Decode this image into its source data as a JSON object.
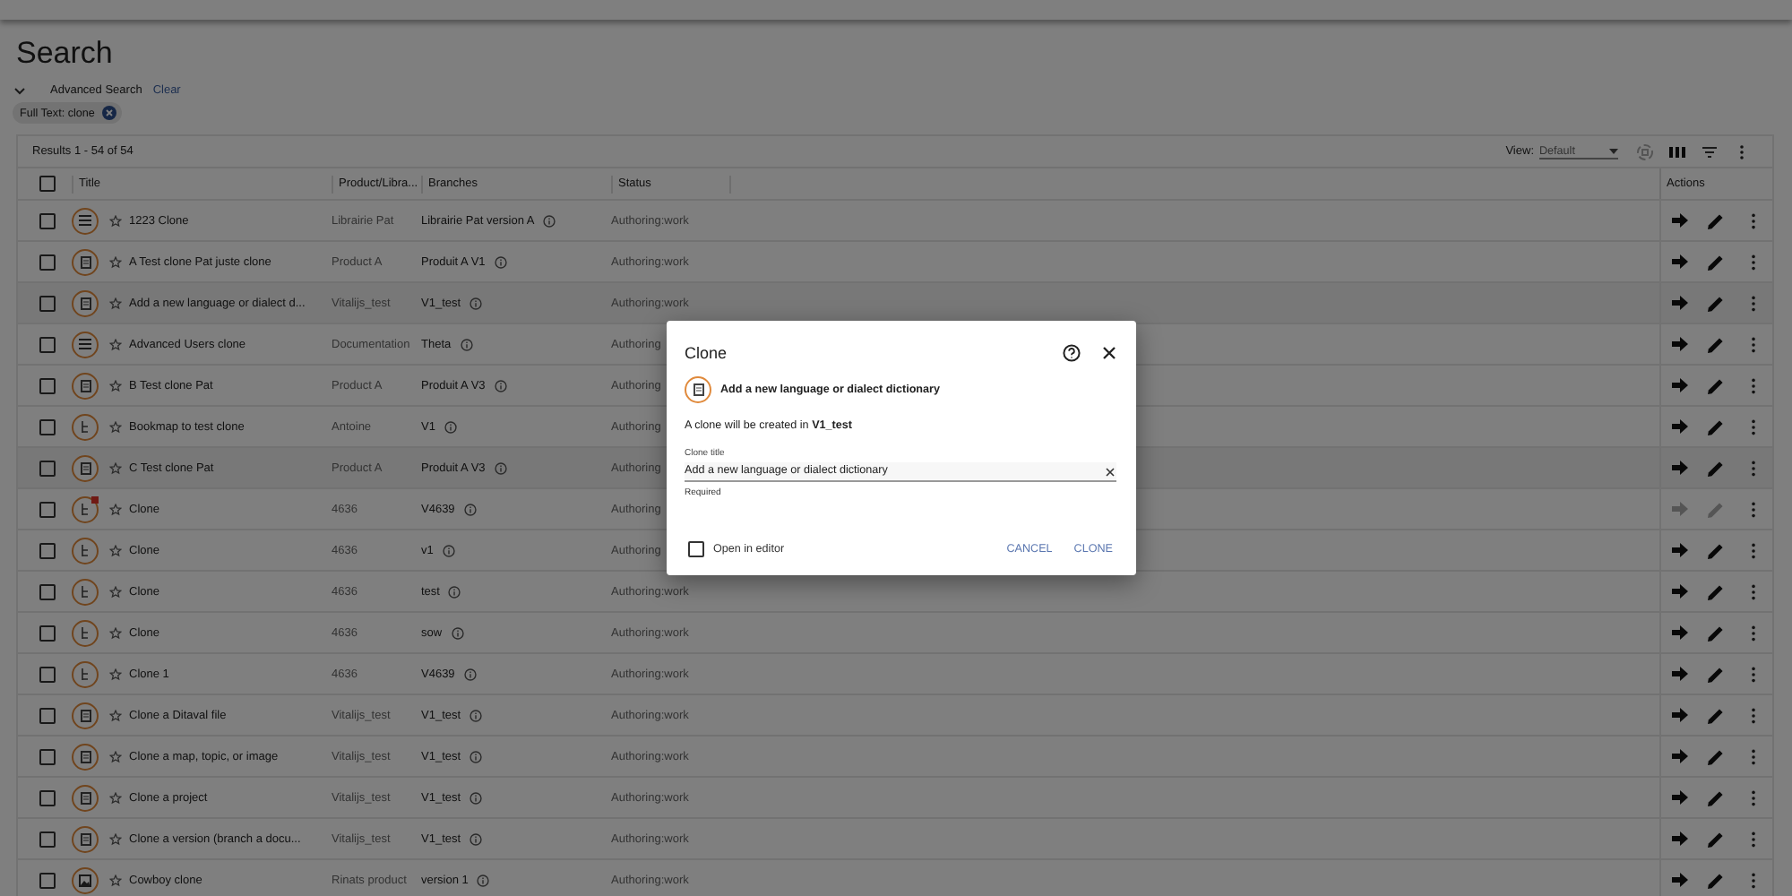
{
  "page": {
    "title": "Search"
  },
  "advanced_search": {
    "label": "Advanced Search",
    "clear": "Clear"
  },
  "filters": [
    {
      "label": "Full Text: clone"
    }
  ],
  "results": {
    "summary": "Results 1 - 54 of 54",
    "view_label": "View:",
    "view_value": "Default"
  },
  "table": {
    "header_checked": false,
    "columns": [
      "Title",
      "Product/Libra...",
      "Branches",
      "Status"
    ],
    "actions_column": "Actions",
    "rows": [
      {
        "kind": "list",
        "title": "1223 Clone",
        "product": "Librairie Pat",
        "branch": "Librairie Pat version A",
        "status": "Authoring:work",
        "checked": false,
        "highlighted": false,
        "alert": false,
        "actions_disabled": false
      },
      {
        "kind": "doc",
        "title": "A Test clone Pat juste clone",
        "product": "Product A",
        "branch": "Produit A V1",
        "status": "Authoring:work",
        "checked": false,
        "highlighted": false,
        "alert": false,
        "actions_disabled": false
      },
      {
        "kind": "doc",
        "title": "Add a new language or dialect d...",
        "product": "Vitalijs_test",
        "branch": "V1_test",
        "status": "Authoring:work",
        "checked": false,
        "highlighted": true,
        "alert": false,
        "actions_disabled": false
      },
      {
        "kind": "list",
        "title": "Advanced Users clone",
        "product": "Documentation",
        "branch": "Theta",
        "status": "Authoring",
        "checked": false,
        "highlighted": false,
        "alert": false,
        "actions_disabled": false
      },
      {
        "kind": "doc",
        "title": "B Test clone Pat",
        "product": "Product A",
        "branch": "Produit A V3",
        "status": "Authoring",
        "checked": false,
        "highlighted": false,
        "alert": false,
        "actions_disabled": false
      },
      {
        "kind": "map",
        "title": "Bookmap to test clone",
        "product": "Antoine",
        "branch": "V1",
        "status": "Authoring",
        "checked": false,
        "highlighted": false,
        "alert": false,
        "actions_disabled": false
      },
      {
        "kind": "doc",
        "title": "C Test clone Pat",
        "product": "Product A",
        "branch": "Produit A V3",
        "status": "Authoring",
        "checked": false,
        "highlighted": true,
        "alert": false,
        "actions_disabled": false
      },
      {
        "kind": "map",
        "title": "Clone",
        "product": "4636",
        "branch": "V4639",
        "status": "Authoring",
        "checked": false,
        "highlighted": false,
        "alert": true,
        "actions_disabled": true
      },
      {
        "kind": "map",
        "title": "Clone",
        "product": "4636",
        "branch": "v1",
        "status": "Authoring",
        "checked": false,
        "highlighted": false,
        "alert": false,
        "actions_disabled": false
      },
      {
        "kind": "map",
        "title": "Clone",
        "product": "4636",
        "branch": "test",
        "status": "Authoring:work",
        "checked": false,
        "highlighted": false,
        "alert": false,
        "actions_disabled": false
      },
      {
        "kind": "map",
        "title": "Clone",
        "product": "4636",
        "branch": "sow",
        "status": "Authoring:work",
        "checked": false,
        "highlighted": false,
        "alert": false,
        "actions_disabled": false
      },
      {
        "kind": "map",
        "title": "Clone 1",
        "product": "4636",
        "branch": "V4639",
        "status": "Authoring:work",
        "checked": false,
        "highlighted": false,
        "alert": false,
        "actions_disabled": false
      },
      {
        "kind": "doc",
        "title": "Clone a Ditaval file",
        "product": "Vitalijs_test",
        "branch": "V1_test",
        "status": "Authoring:work",
        "checked": false,
        "highlighted": false,
        "alert": false,
        "actions_disabled": false
      },
      {
        "kind": "doc",
        "title": "Clone a map, topic, or image",
        "product": "Vitalijs_test",
        "branch": "V1_test",
        "status": "Authoring:work",
        "checked": false,
        "highlighted": false,
        "alert": false,
        "actions_disabled": false
      },
      {
        "kind": "doc",
        "title": "Clone a project",
        "product": "Vitalijs_test",
        "branch": "V1_test",
        "status": "Authoring:work",
        "checked": false,
        "highlighted": false,
        "alert": false,
        "actions_disabled": false
      },
      {
        "kind": "doc",
        "title": "Clone a version (branch a docu...",
        "product": "Vitalijs_test",
        "branch": "V1_test",
        "status": "Authoring:work",
        "checked": false,
        "highlighted": false,
        "alert": false,
        "actions_disabled": false
      },
      {
        "kind": "image",
        "title": "Cowboy clone",
        "product": "Rinats product",
        "branch": "version 1",
        "status": "Authoring:work",
        "checked": false,
        "highlighted": false,
        "alert": false,
        "actions_disabled": false
      }
    ]
  },
  "dialog": {
    "title": "Clone",
    "item": {
      "kind": "doc",
      "title": "Add a new language or dialect dictionary"
    },
    "message": "A clone will be created in **V1_test**",
    "field_label": "Clone title",
    "field_value": "Add a new language or dialect dictionary",
    "helper": "Required",
    "open_in_editor": false,
    "option_label": "Open in editor",
    "buttons": [
      "CANCEL",
      "CLONE"
    ]
  }
}
